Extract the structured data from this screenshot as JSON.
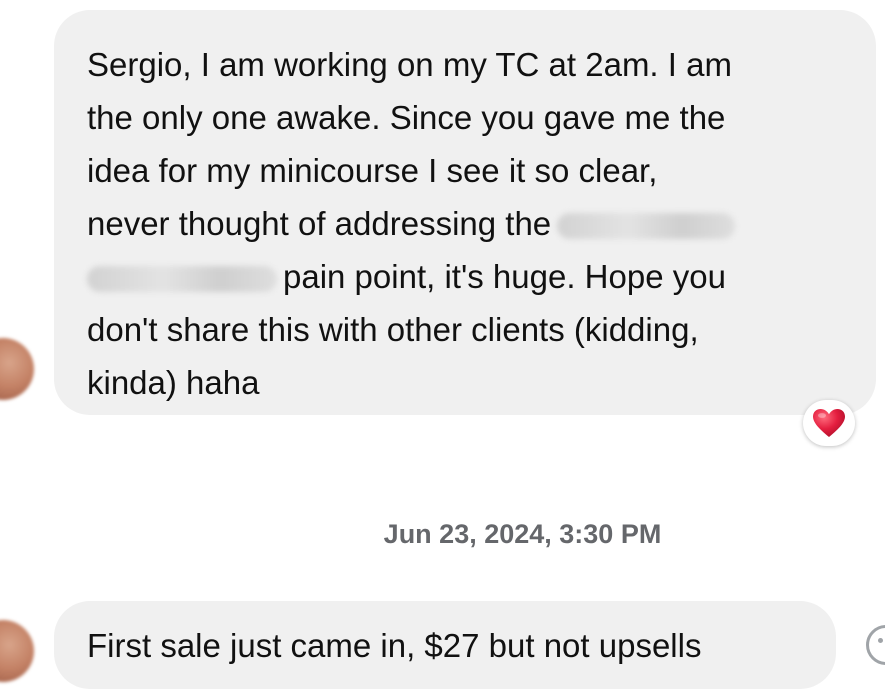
{
  "conversation": {
    "messages": [
      {
        "lines": [
          {
            "text": "Sergio, I am working on my TC at 2am. I am"
          },
          {
            "text": "the only one awake. Since you gave me the"
          },
          {
            "text": "idea for my minicourse I see it so clear,"
          },
          {
            "text": "never thought of addressing the"
          },
          {
            "text": "pain point, it's huge. Hope you"
          },
          {
            "text": "don't share this with other clients (kidding,"
          },
          {
            "text": "kinda) haha"
          }
        ],
        "reaction": "red-heart-icon"
      },
      {
        "lines": [
          {
            "text": "First sale just came in, $27 but not upsells"
          }
        ]
      }
    ],
    "timestamp": "Jun 23, 2024, 3:30 PM"
  },
  "colors": {
    "bubble_bg": "#f0f0f0",
    "text": "#111111",
    "timestamp": "#65676b",
    "heart": "#e41e3f"
  },
  "icons": {
    "reaction": "red-heart-icon",
    "emoji_button": "smiley-face-icon"
  }
}
